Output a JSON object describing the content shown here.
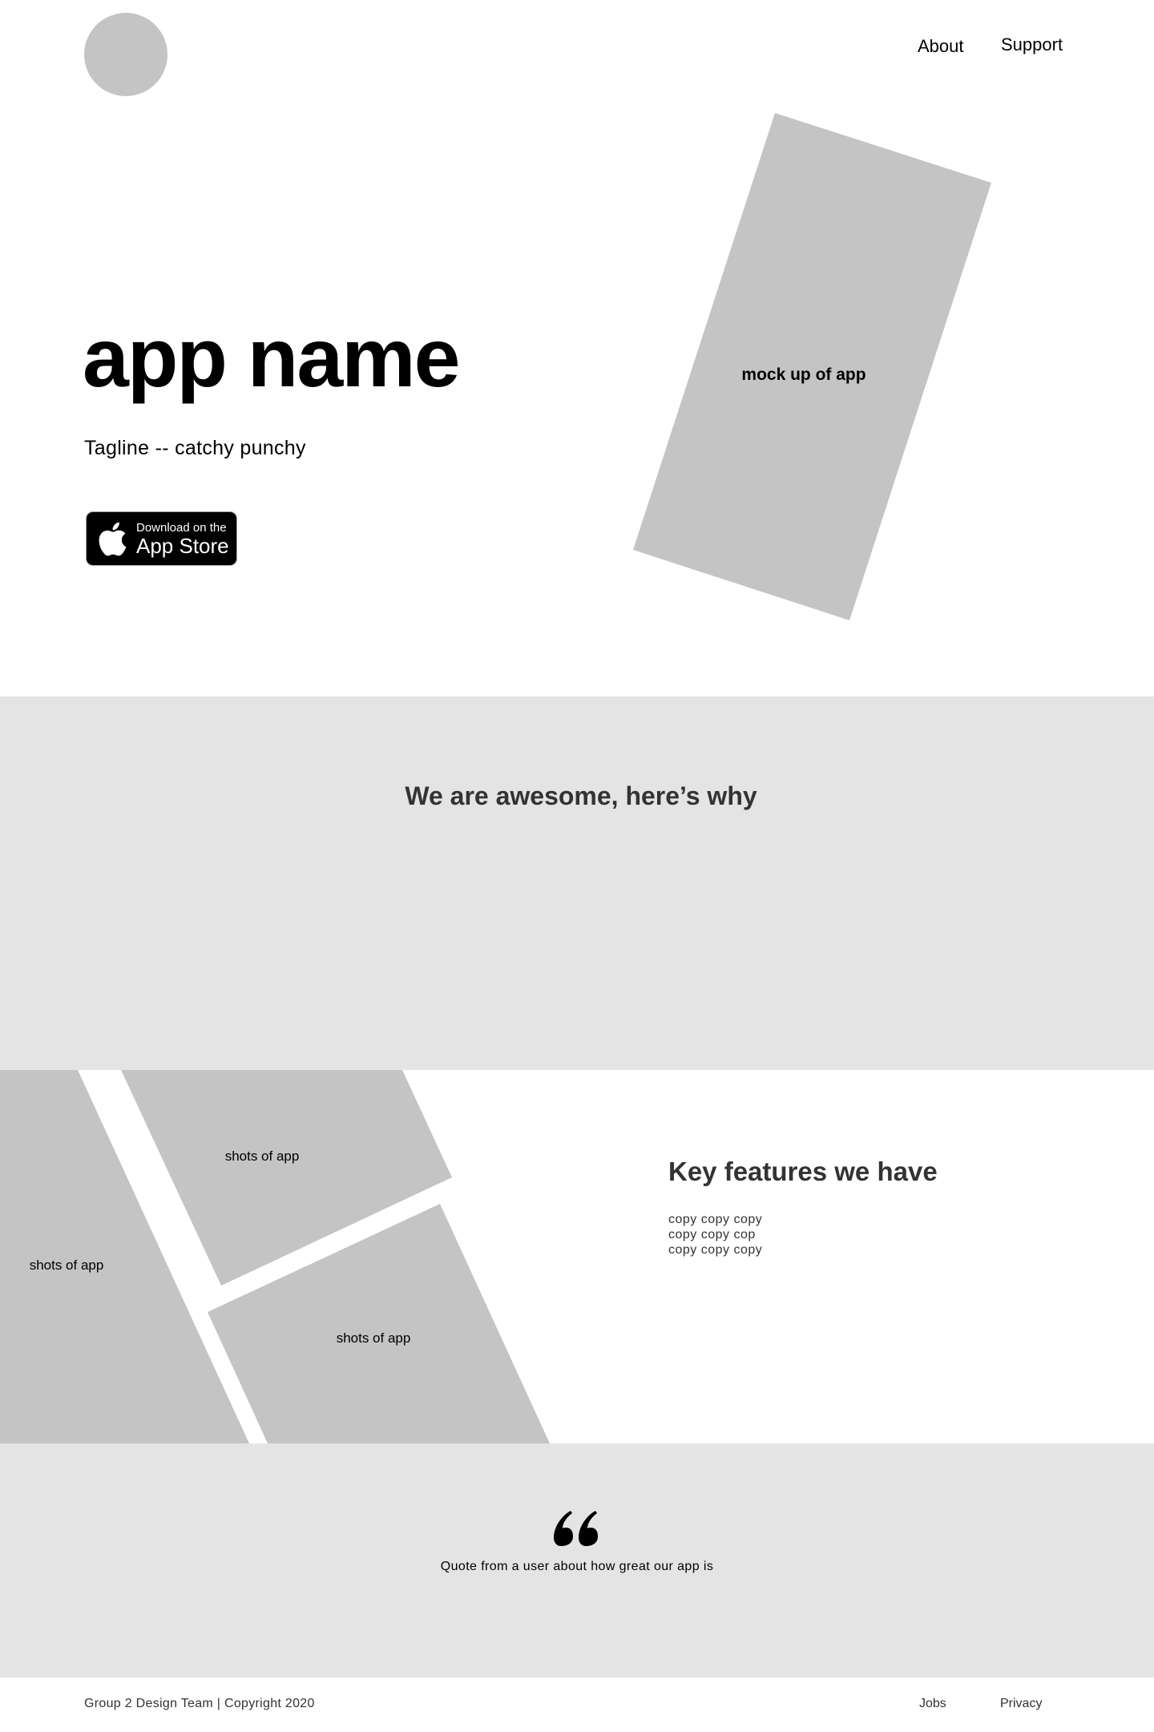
{
  "header": {
    "logo": "logo-placeholder",
    "nav": [
      {
        "label": "About"
      },
      {
        "label": "Support"
      }
    ]
  },
  "hero": {
    "app_name": "app name",
    "tagline": "Tagline -- catchy punchy",
    "app_store_badge": {
      "small_text": "Download on the",
      "big_text": "App Store",
      "icon": "apple-icon"
    },
    "mockup_label": "mock up of app"
  },
  "why": {
    "title": "We are awesome, here’s why"
  },
  "features": {
    "shots": [
      {
        "label": "shots of app"
      },
      {
        "label": "shots of app"
      },
      {
        "label": "shots of app"
      }
    ],
    "title": "Key features we have",
    "copy_lines": [
      "copy copy copy",
      "copy copy cop",
      "copy copy copy"
    ]
  },
  "quote": {
    "icon": "quote-icon",
    "text": "Quote from a user about how great our app is"
  },
  "footer": {
    "copyright": "Group 2 Design Team | Copyright 2020",
    "links": [
      {
        "label": "Jobs"
      },
      {
        "label": "Privacy"
      }
    ]
  },
  "colors": {
    "placeholder_gray": "#c4c4c4",
    "section_bg": "#e4e4e4",
    "text_dark": "#333333"
  }
}
